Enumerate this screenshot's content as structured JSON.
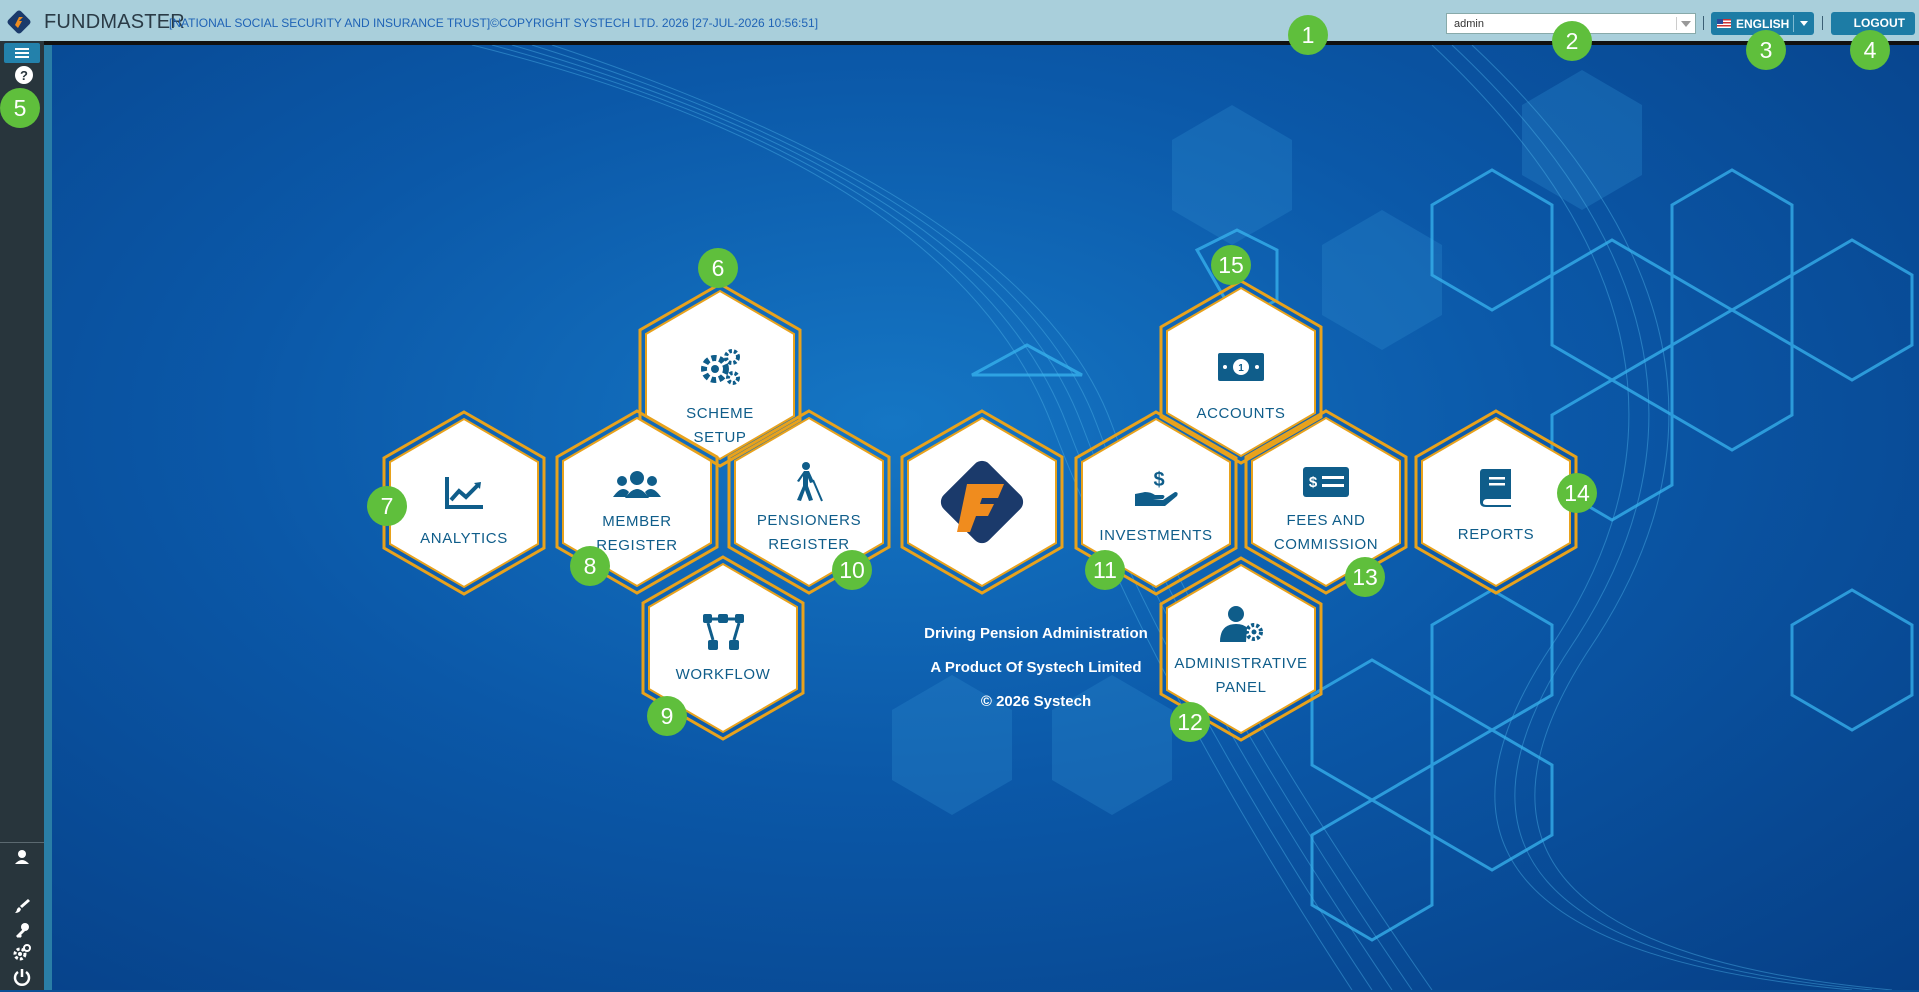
{
  "header": {
    "app_name": "FUNDMASTER",
    "info_text": "[NATIONAL SOCIAL SECURITY AND INSURANCE TRUST]©COPYRIGHT SYSTECH LTD. 2026 [27-JUL-2026 10:56:51]",
    "user_value": "admin",
    "language_label": "ENGLISH",
    "logout_label": "LOGOUT"
  },
  "modules": {
    "scheme_setup": [
      "SCHEME",
      "SETUP"
    ],
    "analytics": [
      "ANALYTICS"
    ],
    "member_register": [
      "MEMBER",
      "REGISTER"
    ],
    "pensioners_register": [
      "PENSIONERS",
      "REGISTER"
    ],
    "workflow": [
      "WORKFLOW"
    ],
    "accounts": [
      "ACCOUNTS"
    ],
    "investments": [
      "INVESTMENTS"
    ],
    "fees_commission": [
      "FEES AND",
      "COMMISSION"
    ],
    "reports": [
      "REPORTS"
    ],
    "administrative_panel": [
      "ADMINISTRATIVE",
      "PANEL"
    ]
  },
  "tagline": {
    "line1": "Driving Pension Administration",
    "line2": "A Product Of Systech Limited",
    "line3": "© 2026 Systech"
  },
  "badges": [
    "1",
    "2",
    "3",
    "4",
    "5",
    "6",
    "7",
    "8",
    "9",
    "10",
    "11",
    "12",
    "13",
    "14",
    "15"
  ],
  "colors": {
    "header_bg": "#a9cfdb",
    "sidebar_bg": "#28353c",
    "accent_blue": "#1d7ca5",
    "hex_border": "#e8a21c",
    "badge_green": "#5fbf3c",
    "logo_orange": "#f08c1e",
    "logo_navy": "#1b3a6b"
  }
}
